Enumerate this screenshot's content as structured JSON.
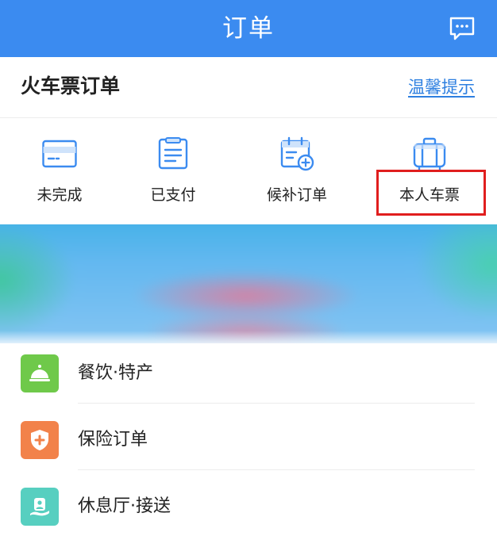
{
  "header": {
    "title": "订单",
    "message_icon": "chat-bubble-icon",
    "background": "#3b8bf0"
  },
  "ticket_orders": {
    "title": "火车票订单",
    "tips_link": "温馨提示",
    "items": [
      {
        "label": "未完成",
        "icon": "card-icon"
      },
      {
        "label": "已支付",
        "icon": "receipt-icon"
      },
      {
        "label": "候补订单",
        "icon": "calendar-add-icon"
      },
      {
        "label": "本人车票",
        "icon": "suitcase-icon"
      }
    ],
    "highlighted_item": "本人车票",
    "highlight_color": "#e01e1e"
  },
  "services": [
    {
      "label": "餐饮·特产",
      "icon": "food-cloche-icon",
      "color": "#6fc94a"
    },
    {
      "label": "保险订单",
      "icon": "shield-plus-icon",
      "color": "#f2824a"
    },
    {
      "label": "休息厅·接送",
      "icon": "lounge-person-icon",
      "color": "#57cfc0"
    }
  ],
  "accent_color": "#2d7fe0"
}
